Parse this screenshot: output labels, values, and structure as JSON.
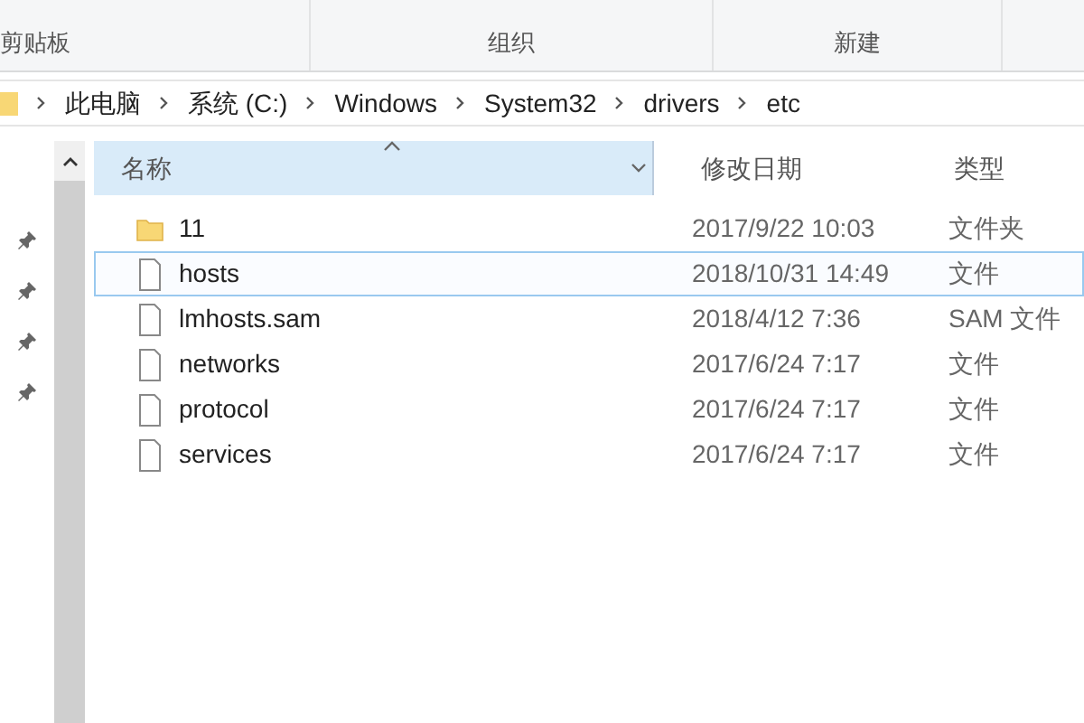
{
  "ribbon": {
    "groups": [
      "剪贴板",
      "组织",
      "新建"
    ]
  },
  "address_bar": {
    "path": [
      "此电脑",
      "系统 (C:)",
      "Windows",
      "System32",
      "drivers",
      "etc"
    ]
  },
  "table": {
    "columns": [
      {
        "label": "名称",
        "sorted": true
      },
      {
        "label": "修改日期",
        "sorted": false
      },
      {
        "label": "类型",
        "sorted": false
      }
    ],
    "rows": [
      {
        "kind": "folder",
        "name": "11",
        "date": "2017/9/22 10:03",
        "type": "文件夹",
        "selected": false
      },
      {
        "kind": "file",
        "name": "hosts",
        "date": "2018/10/31 14:49",
        "type": "文件",
        "selected": true
      },
      {
        "kind": "file",
        "name": "lmhosts.sam",
        "date": "2018/4/12 7:36",
        "type": "SAM 文件",
        "selected": false
      },
      {
        "kind": "file",
        "name": "networks",
        "date": "2017/6/24 7:17",
        "type": "文件",
        "selected": false
      },
      {
        "kind": "file",
        "name": "protocol",
        "date": "2017/6/24 7:17",
        "type": "文件",
        "selected": false
      },
      {
        "kind": "file",
        "name": "services",
        "date": "2017/6/24 7:17",
        "type": "文件",
        "selected": false
      }
    ]
  },
  "nav_pane": {
    "items": [
      {
        "pinned": true
      },
      {
        "pinned": true
      },
      {
        "pinned": true
      },
      {
        "pinned": true
      }
    ]
  }
}
